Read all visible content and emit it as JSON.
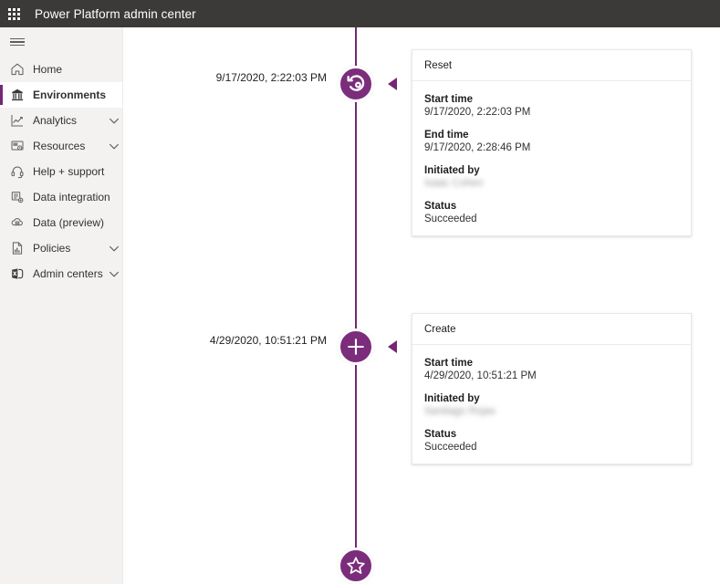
{
  "header": {
    "title": "Power Platform admin center",
    "waffle_icon": "waffle-grid-icon"
  },
  "sidebar": {
    "menu_toggle_icon": "hamburger-icon",
    "items": [
      {
        "label": "Home",
        "icon": "home-icon",
        "selected": false,
        "expandable": false
      },
      {
        "label": "Environments",
        "icon": "environments-icon",
        "selected": true,
        "expandable": false
      },
      {
        "label": "Analytics",
        "icon": "analytics-chart-icon",
        "selected": false,
        "expandable": true
      },
      {
        "label": "Resources",
        "icon": "resources-icon",
        "selected": false,
        "expandable": true
      },
      {
        "label": "Help + support",
        "icon": "headset-icon",
        "selected": false,
        "expandable": false
      },
      {
        "label": "Data integration",
        "icon": "data-integration-icon",
        "selected": false,
        "expandable": false
      },
      {
        "label": "Data (preview)",
        "icon": "cloud-data-icon",
        "selected": false,
        "expandable": false
      },
      {
        "label": "Policies",
        "icon": "policies-document-icon",
        "selected": false,
        "expandable": true
      },
      {
        "label": "Admin centers",
        "icon": "admin-centers-icon",
        "selected": false,
        "expandable": true
      }
    ]
  },
  "colors": {
    "accent_purple": "#742774",
    "node_purple": "#7b2d7b",
    "header_bar": "#3b3a39",
    "sidebar_bg": "#f3f2f1"
  },
  "timeline": {
    "events": [
      {
        "timestamp": "9/17/2020, 2:22:03 PM",
        "icon": "reset-circular-arrow-icon",
        "card": {
          "title": "Reset",
          "fields": [
            {
              "label": "Start time",
              "value": "9/17/2020, 2:22:03 PM",
              "redacted": false
            },
            {
              "label": "End time",
              "value": "9/17/2020, 2:28:46 PM",
              "redacted": false
            },
            {
              "label": "Initiated by",
              "value": "Isaac Cohen",
              "redacted": true
            },
            {
              "label": "Status",
              "value": "Succeeded",
              "redacted": false
            }
          ]
        }
      },
      {
        "timestamp": "4/29/2020, 10:51:21 PM",
        "icon": "plus-icon",
        "card": {
          "title": "Create",
          "fields": [
            {
              "label": "Start time",
              "value": "4/29/2020, 10:51:21 PM",
              "redacted": false
            },
            {
              "label": "Initiated by",
              "value": "Santiago Rojas",
              "redacted": true
            },
            {
              "label": "Status",
              "value": "Succeeded",
              "redacted": false
            }
          ]
        }
      }
    ],
    "end_node": {
      "icon": "star-icon"
    }
  }
}
